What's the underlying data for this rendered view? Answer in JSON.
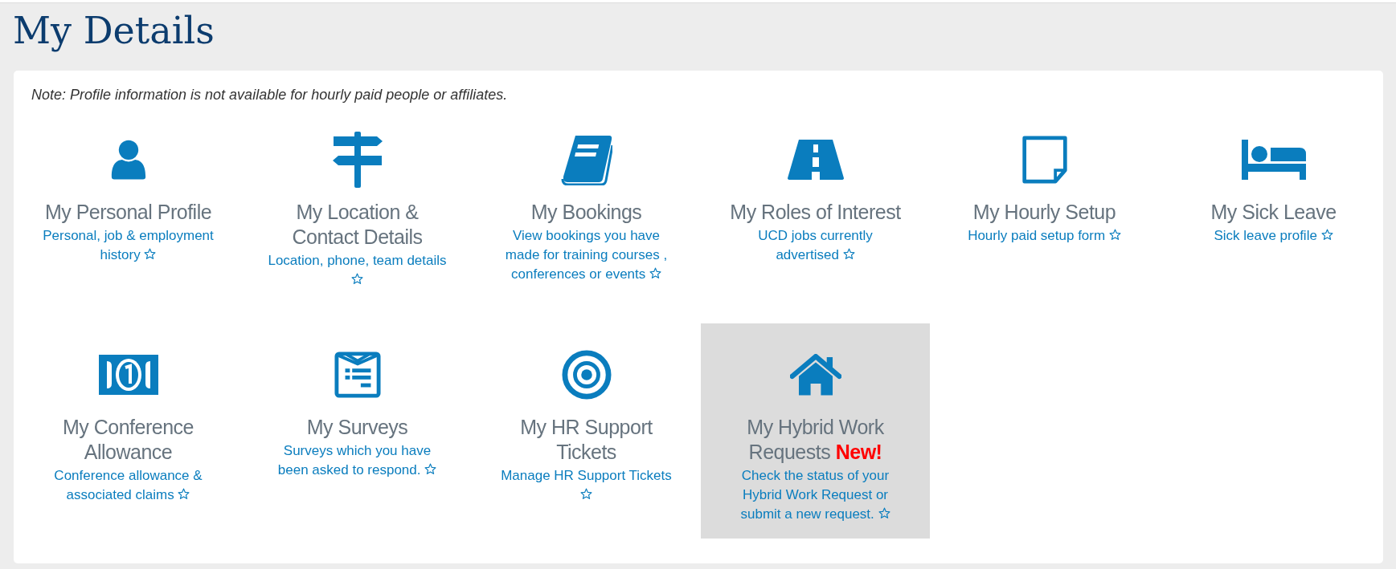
{
  "page_title": "My Details",
  "note": "Note: Profile information is not available for hourly paid people or affiliates.",
  "tiles": [
    {
      "kind": "person",
      "title": "My Personal Profile",
      "description": "Personal, job & employment history",
      "selected": false
    },
    {
      "kind": "signpost",
      "title": "My Location & Contact Details",
      "description": "Location, phone, team details",
      "selected": false
    },
    {
      "kind": "book",
      "title": "My Bookings",
      "description": "View bookings you have made for training courses , conferences or events",
      "selected": false
    },
    {
      "kind": "road",
      "title": "My Roles of Interest",
      "description": "UCD jobs currently advertised",
      "selected": false
    },
    {
      "kind": "note",
      "title": "My Hourly Setup",
      "description": "Hourly paid setup form",
      "selected": false
    },
    {
      "kind": "bed",
      "title": "My Sick Leave",
      "description": "Sick leave profile",
      "selected": false
    },
    {
      "kind": "money",
      "title": "My Conference Allowance",
      "description": "Conference allowance & associated claims",
      "selected": false
    },
    {
      "kind": "survey",
      "title": "My Surveys",
      "description": "Surveys which you have been asked to respond.",
      "selected": false
    },
    {
      "kind": "target",
      "title": "My HR Support Tickets",
      "description": "Manage HR Support Tickets",
      "selected": false
    },
    {
      "kind": "home",
      "title": "My Hybrid Work Requests",
      "badge": "New!",
      "description": "Check the status of your Hybrid Work Request or submit a new request.",
      "selected": true
    }
  ]
}
